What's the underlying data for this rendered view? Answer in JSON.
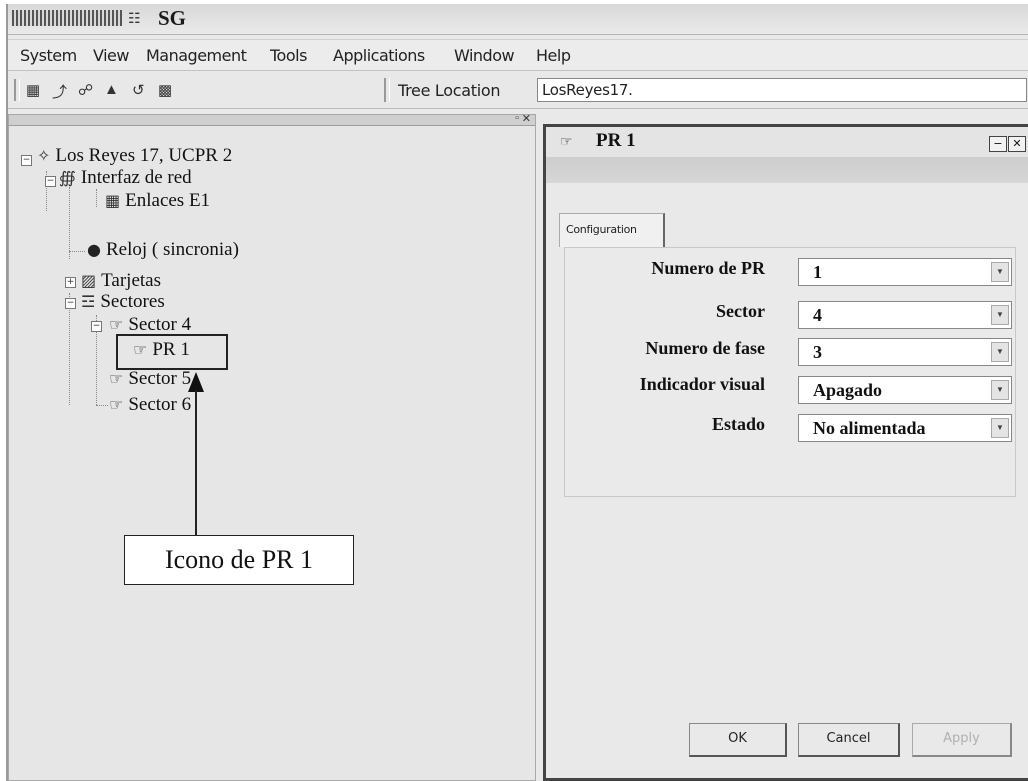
{
  "window": {
    "title": "SG"
  },
  "menu": [
    "System",
    "View",
    "Management",
    "Tools",
    "Applications",
    "Window",
    "Help"
  ],
  "toolbar": {
    "tree_location_label": "Tree Location",
    "tree_location_value": "LosReyes17."
  },
  "tree": {
    "root": "Los Reyes 17, UCPR 2",
    "interfaz": "Interfaz de red",
    "enlaces": "Enlaces E1",
    "reloj": "Reloj ( sincronia)",
    "tarjetas": "Tarjetas",
    "sectores": "Sectores",
    "sector4": "Sector 4",
    "pr1": "PR 1",
    "sector5": "Sector 5",
    "sector6": "Sector 6"
  },
  "annotation": {
    "callout": "Icono de PR 1"
  },
  "dialog": {
    "title": "PR 1",
    "tab": "Configuration",
    "fields": [
      {
        "label": "Numero de PR",
        "value": "1"
      },
      {
        "label": "Sector",
        "value": "4"
      },
      {
        "label": "Numero de fase",
        "value": "3"
      },
      {
        "label": "Indicador visual",
        "value": "Apagado"
      },
      {
        "label": "Estado",
        "value": "No alimentada"
      }
    ],
    "buttons": {
      "ok": "OK",
      "cancel": "Cancel",
      "apply": "Apply"
    }
  }
}
